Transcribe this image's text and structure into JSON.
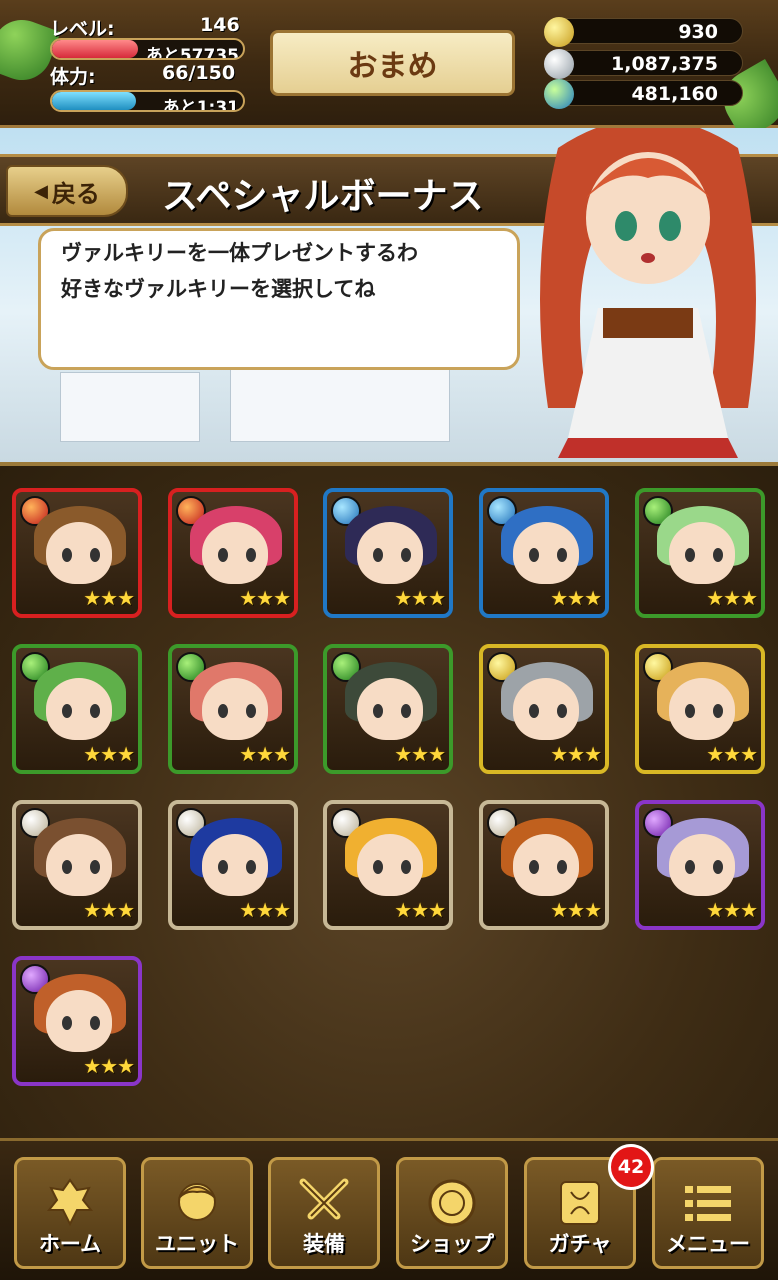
{
  "header": {
    "level_label": "レベル:",
    "level_value": "146",
    "exp_remaining": "あと57735",
    "exp_fraction": 0.45,
    "stamina_label": "体力:",
    "stamina_value": "66/150",
    "stamina_timer": "あと1:31",
    "stamina_fraction": 0.44,
    "player_name": "おまめ",
    "currencies": {
      "gold": "930",
      "silver": "1,087,375",
      "gem": "481,160"
    }
  },
  "story": {
    "back_label": "戻る",
    "title": "スペシャルボーナス",
    "message_line1": "ヴァルキリーを一体プレゼントするわ",
    "message_line2": "好きなヴァルキリーを選択してね"
  },
  "units": [
    {
      "element": "fire",
      "hair": "#8a5a2b",
      "stars": "★★★"
    },
    {
      "element": "fire",
      "hair": "#d8406a",
      "stars": "★★★"
    },
    {
      "element": "water",
      "hair": "#2e2a56",
      "stars": "★★★"
    },
    {
      "element": "water",
      "hair": "#2f6fc4",
      "stars": "★★★"
    },
    {
      "element": "wind",
      "hair": "#9ad88a",
      "stars": "★★★"
    },
    {
      "element": "wind",
      "hair": "#5fb04a",
      "stars": "★★★"
    },
    {
      "element": "wind",
      "hair": "#e0786a",
      "stars": "★★★"
    },
    {
      "element": "wind",
      "hair": "#3d4a3a",
      "stars": "★★★"
    },
    {
      "element": "light",
      "hair": "#9da3a8",
      "stars": "★★★"
    },
    {
      "element": "light",
      "hair": "#e6b25a",
      "stars": "★★★"
    },
    {
      "element": "neutral",
      "hair": "#7a5030",
      "stars": "★★★"
    },
    {
      "element": "neutral",
      "hair": "#1e3aa0",
      "stars": "★★★"
    },
    {
      "element": "neutral",
      "hair": "#f0b030",
      "stars": "★★★"
    },
    {
      "element": "neutral",
      "hair": "#c0601e",
      "stars": "★★★"
    },
    {
      "element": "dark",
      "hair": "#a69ad6",
      "stars": "★★★"
    },
    {
      "element": "dark",
      "hair": "#c0602a",
      "stars": "★★★"
    }
  ],
  "nav": {
    "home": "ホーム",
    "unit": "ユニット",
    "equip": "装備",
    "shop": "ショップ",
    "gacha": "ガチャ",
    "menu": "メニュー",
    "gacha_badge": "42"
  },
  "colors": {
    "frame_gold": "#c29a47",
    "panel_brown": "#3f2d15"
  }
}
